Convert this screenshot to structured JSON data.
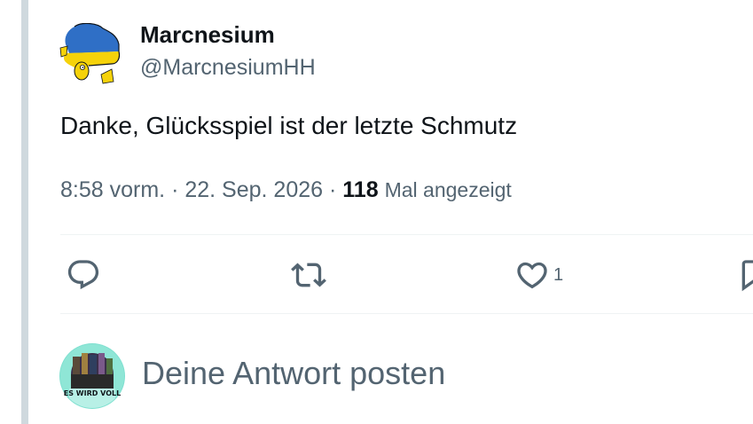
{
  "tweet": {
    "author": {
      "display_name": "Marcnesium",
      "handle": "@MarcnesiumHH"
    },
    "text": "Danke, Glücksspiel ist der letzte Schmutz",
    "meta": {
      "time": "8:58 vorm.",
      "separator": "·",
      "date": "22. Sep. 2026",
      "views_count": "118",
      "views_label": "Mal angezeigt"
    },
    "actions": {
      "reply_icon": "reply-icon",
      "retweet_icon": "retweet-icon",
      "like_icon": "heart-icon",
      "like_count": "1",
      "bookmark_icon": "bookmark-icon"
    }
  },
  "reply_box": {
    "placeholder": "Deine Antwort posten",
    "avatar_caption": "ES WIRD VOLL"
  },
  "colors": {
    "text_primary": "#0f1419",
    "text_secondary": "#536471",
    "divider": "#eff3f4",
    "rail": "#cfd9de",
    "ukraine_blue": "#2f6fc6",
    "ukraine_yellow": "#f5d20a"
  }
}
